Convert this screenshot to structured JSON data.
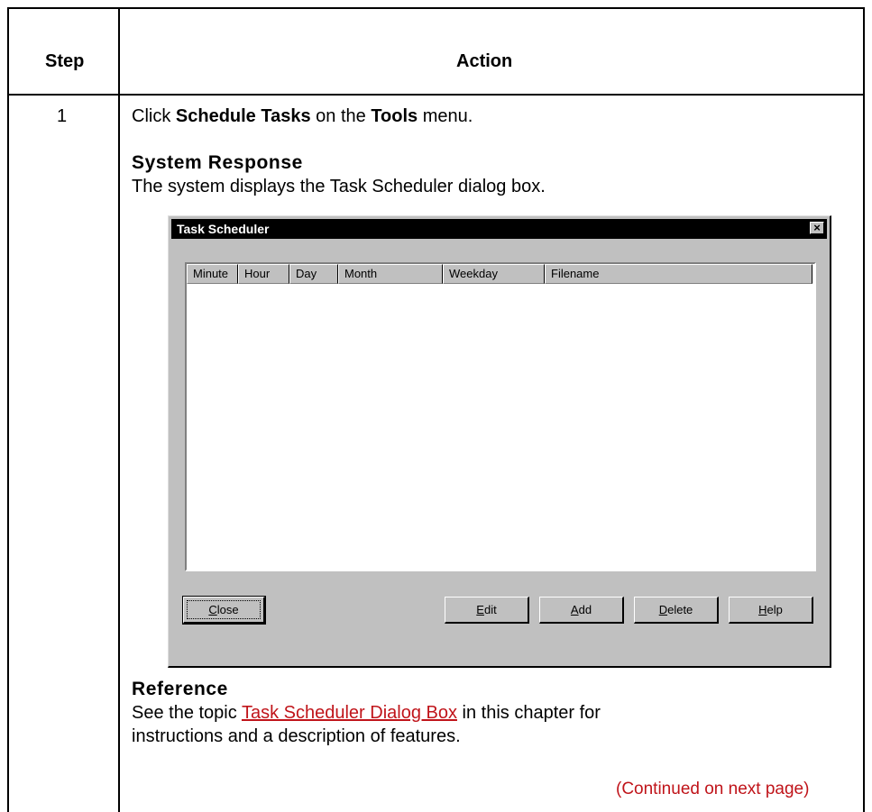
{
  "table": {
    "header_step": "Step",
    "header_action": "Action",
    "step_number": "1",
    "instruction": {
      "prefix": "Click ",
      "item": "Schedule Tasks",
      "middle": " on the ",
      "menu": "Tools",
      "suffix": " menu."
    },
    "system_response": {
      "heading": "System Response",
      "text": "The system displays the Task Scheduler dialog box."
    },
    "reference": {
      "heading": "Reference",
      "prefix": "See the topic ",
      "link": "Task Scheduler Dialog Box",
      "suffix": " in this chapter for",
      "line2": "instructions and a description of features."
    },
    "continued": "(Continued on next page)"
  },
  "dialog": {
    "title": "Task Scheduler",
    "close_glyph": "×",
    "columns": [
      "Minute",
      "Hour",
      "Day",
      "Month",
      "Weekday",
      "Filename"
    ],
    "buttons": {
      "close": {
        "mnemonic": "C",
        "rest": "lose"
      },
      "edit": {
        "mnemonic": "E",
        "rest": "dit"
      },
      "add": {
        "mnemonic": "A",
        "rest": "dd"
      },
      "delete": {
        "mnemonic": "D",
        "rest": "elete"
      },
      "help": {
        "mnemonic": "H",
        "rest": "elp"
      }
    }
  },
  "colors": {
    "link": "#c0141a",
    "dialog_face": "#c0c0c0",
    "titlebar": "#000000"
  }
}
